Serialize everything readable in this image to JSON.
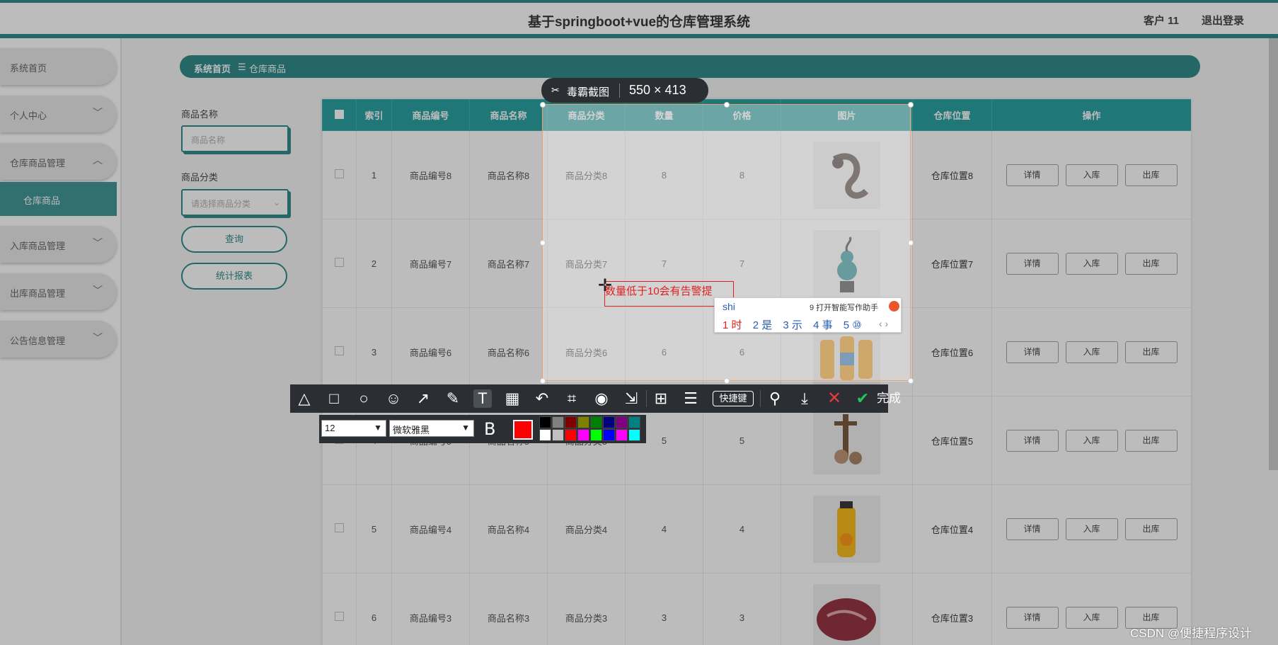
{
  "app": {
    "title": "基于springboot+vue的仓库管理系统",
    "user": "客户 11",
    "logout": "退出登录"
  },
  "sidebar": {
    "items": [
      {
        "label": "系统首页"
      },
      {
        "label": "个人中心",
        "chevron": "﹀"
      },
      {
        "label": "仓库商品管理",
        "chevron": "︿"
      },
      {
        "label": "入库商品管理",
        "chevron": "﹀"
      },
      {
        "label": "出库商品管理",
        "chevron": "﹀"
      },
      {
        "label": "公告信息管理",
        "chevron": "﹀"
      }
    ],
    "sub_item": "仓库商品"
  },
  "breadcrumb": {
    "home": "系统首页",
    "sep": "☰",
    "current": "仓库商品"
  },
  "filters": {
    "name_label": "商品名称",
    "name_placeholder": "商品名称",
    "category_label": "商品分类",
    "category_placeholder": "请选择商品分类",
    "query_btn": "查询",
    "report_btn": "统计报表"
  },
  "table": {
    "headers": [
      "索引",
      "商品编号",
      "商品名称",
      "商品分类",
      "数量",
      "价格",
      "图片",
      "仓库位置",
      "操作"
    ],
    "actions": {
      "detail": "详情",
      "in": "入库",
      "out": "出库"
    },
    "rows": [
      {
        "idx": "1",
        "code": "商品编号8",
        "name": "商品名称8",
        "cat": "商品分类8",
        "qty": "8",
        "price": "8",
        "loc": "仓库位置8",
        "img": "rope"
      },
      {
        "idx": "2",
        "code": "商品编号7",
        "name": "商品名称7",
        "cat": "商品分类7",
        "qty": "7",
        "price": "7",
        "loc": "仓库位置7",
        "img": "gourd"
      },
      {
        "idx": "3",
        "code": "商品编号6",
        "name": "商品名称6",
        "cat": "商品分类6",
        "qty": "6",
        "price": "6",
        "loc": "仓库位置6",
        "img": "juice-bottles"
      },
      {
        "idx": "4",
        "code": "商品编号5",
        "name": "商品名称5",
        "cat": "商品分类5",
        "qty": "5",
        "price": "5",
        "loc": "仓库位置5",
        "img": "figurine"
      },
      {
        "idx": "5",
        "code": "商品编号4",
        "name": "商品名称4",
        "cat": "商品分类4",
        "qty": "4",
        "price": "4",
        "loc": "仓库位置4",
        "img": "orange-juice"
      },
      {
        "idx": "6",
        "code": "商品编号3",
        "name": "商品名称3",
        "cat": "商品分类3",
        "qty": "3",
        "price": "3",
        "loc": "仓库位置3",
        "img": "meat"
      }
    ]
  },
  "capture_tool": {
    "name": "毒霸截图",
    "dimensions": "550 × 413",
    "annotation_text": "数量低于10会有告警提",
    "ime": {
      "composition": "shi",
      "assistant": "9 打开智能写作助手",
      "candidates": [
        "1 时",
        "2 是",
        "3 示",
        "4 事",
        "5 ⑩"
      ],
      "pager": "‹ ›"
    },
    "toolbar": {
      "shortcut": "快捷键",
      "done": "完成"
    },
    "text_options": {
      "font_size": "12",
      "font_name": "微软雅黑",
      "bold": "B",
      "current_color": "#ff0000"
    },
    "palette": [
      "#000000",
      "#808080",
      "#800000",
      "#808000",
      "#008000",
      "#000080",
      "#800080",
      "#008080",
      "#ffffff",
      "#c0c0c0",
      "#ff0000",
      "#ff00ff",
      "#00ff00",
      "#0000ff",
      "#ff00ff",
      "#00ffff"
    ]
  },
  "colors": {
    "brand": "#1a7f7f",
    "header": "#139797",
    "annotation": "#e02020"
  },
  "watermark": "CSDN @便捷程序设计"
}
